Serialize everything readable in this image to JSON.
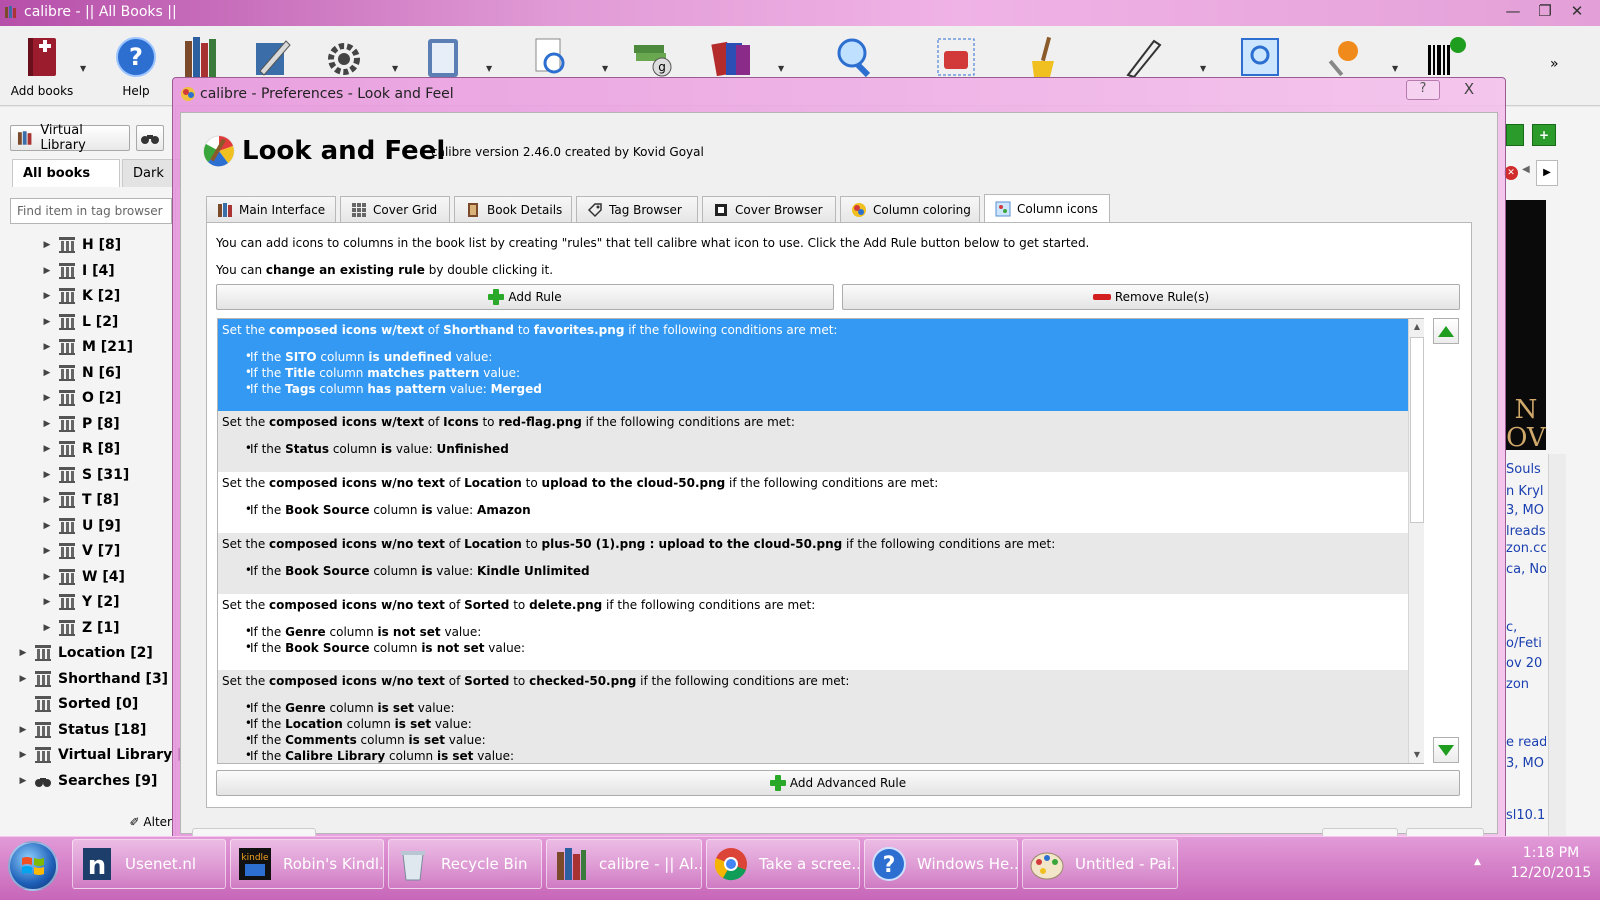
{
  "window": {
    "title": "calibre - || All Books ||"
  },
  "toolbar": {
    "items": [
      {
        "label": "Add books",
        "icon": "add-books-icon"
      },
      {
        "label": "Help",
        "icon": "help-icon"
      }
    ],
    "overflow": "»"
  },
  "left_panel": {
    "virtual_library": "Virtual Library",
    "tabs": [
      "All books",
      "Dark"
    ],
    "search_placeholder": "Find item in tag browser",
    "tags": [
      {
        "label": "H [8]",
        "level": 1
      },
      {
        "label": "I [4]",
        "level": 1
      },
      {
        "label": "K [2]",
        "level": 1
      },
      {
        "label": "L [2]",
        "level": 1
      },
      {
        "label": "M [21]",
        "level": 1
      },
      {
        "label": "N [6]",
        "level": 1
      },
      {
        "label": "O [2]",
        "level": 1
      },
      {
        "label": "P [8]",
        "level": 1
      },
      {
        "label": "R [8]",
        "level": 1
      },
      {
        "label": "S [31]",
        "level": 1
      },
      {
        "label": "T [8]",
        "level": 1
      },
      {
        "label": "U [9]",
        "level": 1
      },
      {
        "label": "V [7]",
        "level": 1
      },
      {
        "label": "W [4]",
        "level": 1
      },
      {
        "label": "Y [2]",
        "level": 1
      },
      {
        "label": "Z [1]",
        "level": 1
      },
      {
        "label": "Location [2]",
        "level": 0
      },
      {
        "label": "Shorthand [3]",
        "level": 0
      },
      {
        "label": "Sorted [0]",
        "level": 0
      },
      {
        "label": "Status [18]",
        "level": 0
      },
      {
        "label": "Virtual Library [",
        "level": 0
      },
      {
        "label": "Searches [9]",
        "level": 0
      }
    ],
    "alter_label": "Alter"
  },
  "right_panel": {
    "cover_text": "N\nOV",
    "snippets": [
      "Souls",
      "n Kryl",
      "3, MO",
      "lreads",
      "zon.cc",
      "ca, No",
      "c,",
      "o/Feti",
      "ov 20",
      "zon",
      "e read",
      "3, MO",
      "sl10.1"
    ]
  },
  "dialog": {
    "title": "calibre - Preferences - Look and Feel",
    "help": "?",
    "close": "X",
    "heading": "Look and Feel",
    "version": "calibre version 2.46.0 created by Kovid Goyal",
    "tabs": [
      {
        "label": "Main Interface",
        "active": false
      },
      {
        "label": "Cover Grid",
        "active": false
      },
      {
        "label": "Book Details",
        "active": false
      },
      {
        "label": "Tag Browser",
        "active": false
      },
      {
        "label": "Cover Browser",
        "active": false
      },
      {
        "label": "Column coloring",
        "active": false
      },
      {
        "label": "Column icons",
        "active": true
      }
    ],
    "intro": "You can add icons to columns in the book list by creating \"rules\" that tell calibre what icon to use. Click the Add Rule button below to get started.",
    "intro2_pre": "You can ",
    "intro2_bold": "change an existing rule",
    "intro2_post": " by double clicking it.",
    "add_rule": "Add Rule",
    "remove_rule": "Remove Rule(s)",
    "add_advanced_rule": "Add Advanced Rule",
    "rules": [
      {
        "selected": true,
        "parts": [
          "Set the ",
          "composed icons w/text",
          " of ",
          "Shorthand",
          " to ",
          "favorites.png",
          " if the following conditions are met:"
        ],
        "conditions": [
          [
            "If the ",
            "SITO",
            " column ",
            "is undefined",
            " value:",
            ""
          ],
          [
            "If the ",
            "Title",
            " column ",
            "matches pattern",
            " value:",
            ""
          ],
          [
            "If the ",
            "Tags",
            " column ",
            "has pattern",
            " value: ",
            "Merged"
          ]
        ]
      },
      {
        "selected": false,
        "parts": [
          "Set the ",
          "composed icons w/text",
          " of ",
          "Icons",
          " to ",
          "red-flag.png",
          " if the following conditions are met:"
        ],
        "conditions": [
          [
            "If the ",
            "Status",
            " column ",
            "is",
            " value: ",
            "Unfinished"
          ]
        ]
      },
      {
        "selected": false,
        "parts": [
          "Set the ",
          "composed icons w/no text",
          " of ",
          "Location",
          " to ",
          "upload to the cloud-50.png",
          " if the following conditions are met:"
        ],
        "conditions": [
          [
            "If the ",
            "Book Source",
            " column ",
            "is",
            " value: ",
            "Amazon"
          ]
        ]
      },
      {
        "selected": false,
        "parts": [
          "Set the ",
          "composed icons w/no text",
          " of ",
          "Location",
          " to ",
          "plus-50 (1).png : upload to the cloud-50.png",
          " if the following conditions are met:"
        ],
        "conditions": [
          [
            "If the ",
            "Book Source",
            " column ",
            "is",
            " value: ",
            "Kindle Unlimited"
          ]
        ]
      },
      {
        "selected": false,
        "parts": [
          "Set the ",
          "composed icons w/no text",
          " of ",
          "Sorted",
          " to ",
          "delete.png",
          " if the following conditions are met:"
        ],
        "conditions": [
          [
            "If the ",
            "Genre",
            " column ",
            "is not set",
            " value:",
            ""
          ],
          [
            "If the ",
            "Book Source",
            " column ",
            "is not set",
            " value:",
            ""
          ]
        ]
      },
      {
        "selected": false,
        "parts": [
          "Set the ",
          "composed icons w/no text",
          " of ",
          "Sorted",
          " to ",
          "checked-50.png",
          " if the following conditions are met:"
        ],
        "conditions": [
          [
            "If the ",
            "Genre",
            " column ",
            "is set",
            " value:",
            ""
          ],
          [
            "If the ",
            "Location",
            " column ",
            "is set",
            " value:",
            ""
          ],
          [
            "If the ",
            "Comments",
            " column ",
            "is set",
            " value:",
            ""
          ],
          [
            "If the ",
            "Calibre Library",
            " column ",
            "is set",
            " value:",
            ""
          ]
        ]
      }
    ]
  },
  "taskbar": {
    "items": [
      {
        "label": "Usenet.nl",
        "icon": "usenet-icon"
      },
      {
        "label": "Robin's Kindl...",
        "icon": "kindle-icon"
      },
      {
        "label": "Recycle Bin",
        "icon": "recycle-bin-icon"
      },
      {
        "label": "calibre - || Al...",
        "icon": "calibre-icon"
      },
      {
        "label": "Take a scree...",
        "icon": "chrome-icon"
      },
      {
        "label": "Windows He...",
        "icon": "help-icon"
      },
      {
        "label": "Untitled - Pai...",
        "icon": "paint-icon"
      }
    ],
    "time": "1:18 PM",
    "date": "12/20/2015"
  },
  "colors": {
    "selection": "#3399f3",
    "titlebar": "#e19bd6",
    "accent_green": "#1f9d1f"
  }
}
